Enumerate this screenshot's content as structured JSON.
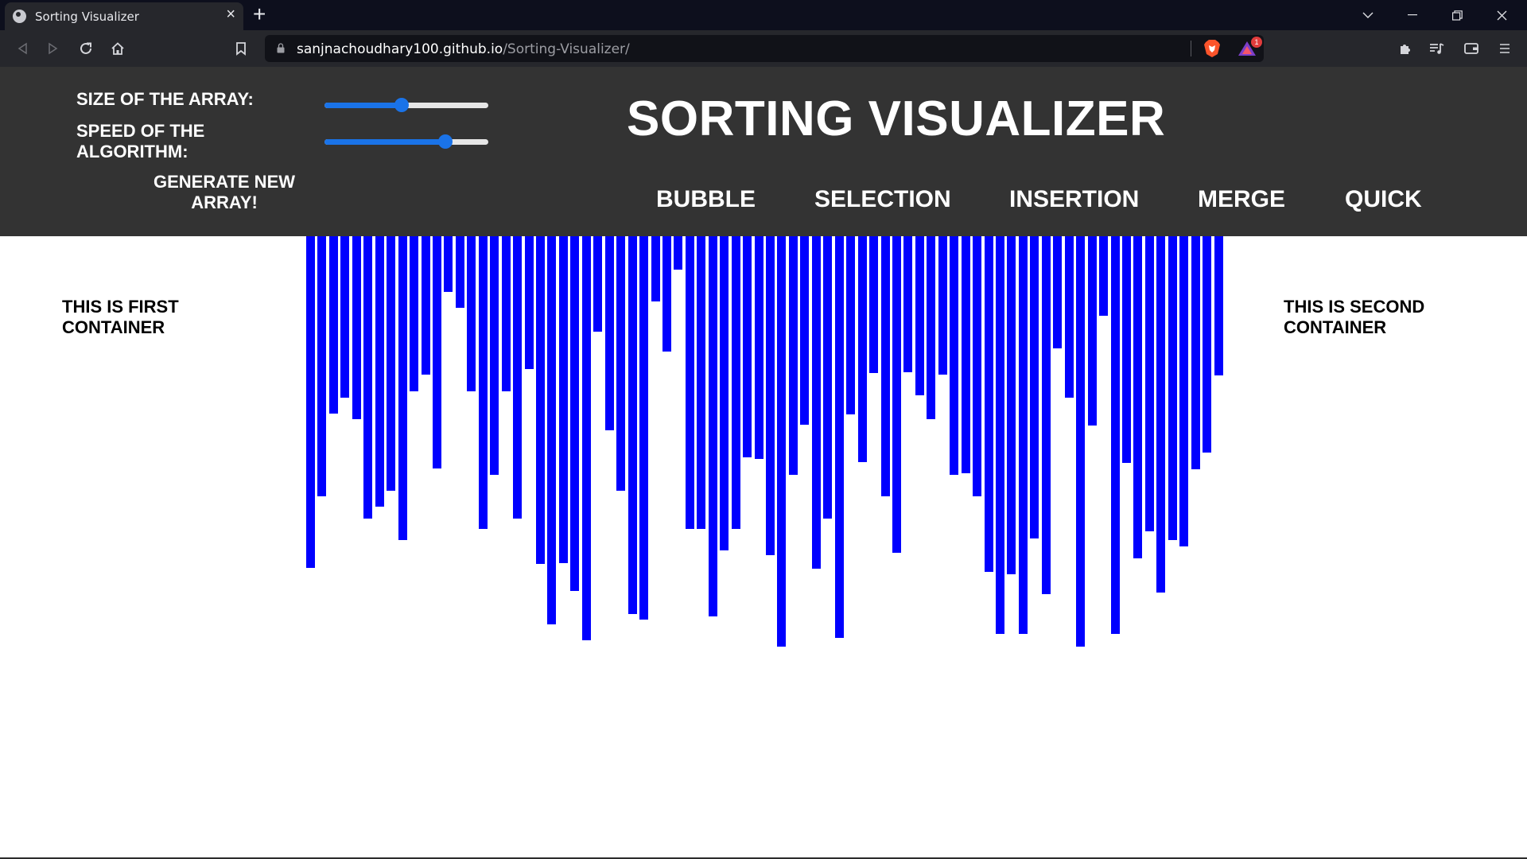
{
  "browser": {
    "tab_title": "Sorting Visualizer",
    "url_host": "sanjnachoudhary100.github.io",
    "url_path": "/Sorting-Visualizer/",
    "notification_count": "1"
  },
  "header": {
    "size_label": "SIZE OF THE ARRAY:",
    "speed_label_line1": "SPEED OF THE",
    "speed_label_line2": "ALGORITHM:",
    "generate_line1": "GENERATE NEW",
    "generate_line2": "ARRAY!",
    "title": "SORTING VISUALIZER",
    "size_slider_value": 0.47,
    "speed_slider_value": 0.74,
    "algorithms": [
      "BUBBLE",
      "SELECTION",
      "INSERTION",
      "MERGE",
      "QUICK"
    ]
  },
  "content": {
    "first_container_line1": "THIS IS FIRST",
    "first_container_line2": "CONTAINER",
    "second_container_line1": "THIS IS SECOND",
    "second_container_line2": "CONTAINER",
    "bar_color": "#0000ff",
    "bar_values": [
      417,
      327,
      223,
      203,
      230,
      355,
      340,
      320,
      382,
      195,
      174,
      292,
      70,
      90,
      195,
      368,
      300,
      195,
      355,
      167,
      412,
      488,
      411,
      446,
      508,
      120,
      244,
      320,
      475,
      482,
      82,
      145,
      42,
      368,
      368,
      478,
      395,
      368,
      278,
      280,
      401,
      516,
      300,
      237,
      418,
      355,
      505,
      224,
      284,
      172,
      327,
      398,
      171,
      200,
      230,
      174,
      300,
      298,
      327,
      422,
      500,
      425,
      500,
      380,
      450,
      141,
      203,
      516,
      238,
      100,
      500,
      285,
      405,
      371,
      448,
      382,
      390,
      293,
      272,
      175
    ]
  },
  "colors": {
    "header_bg": "#333333",
    "slider_accent": "#1a73e8"
  }
}
